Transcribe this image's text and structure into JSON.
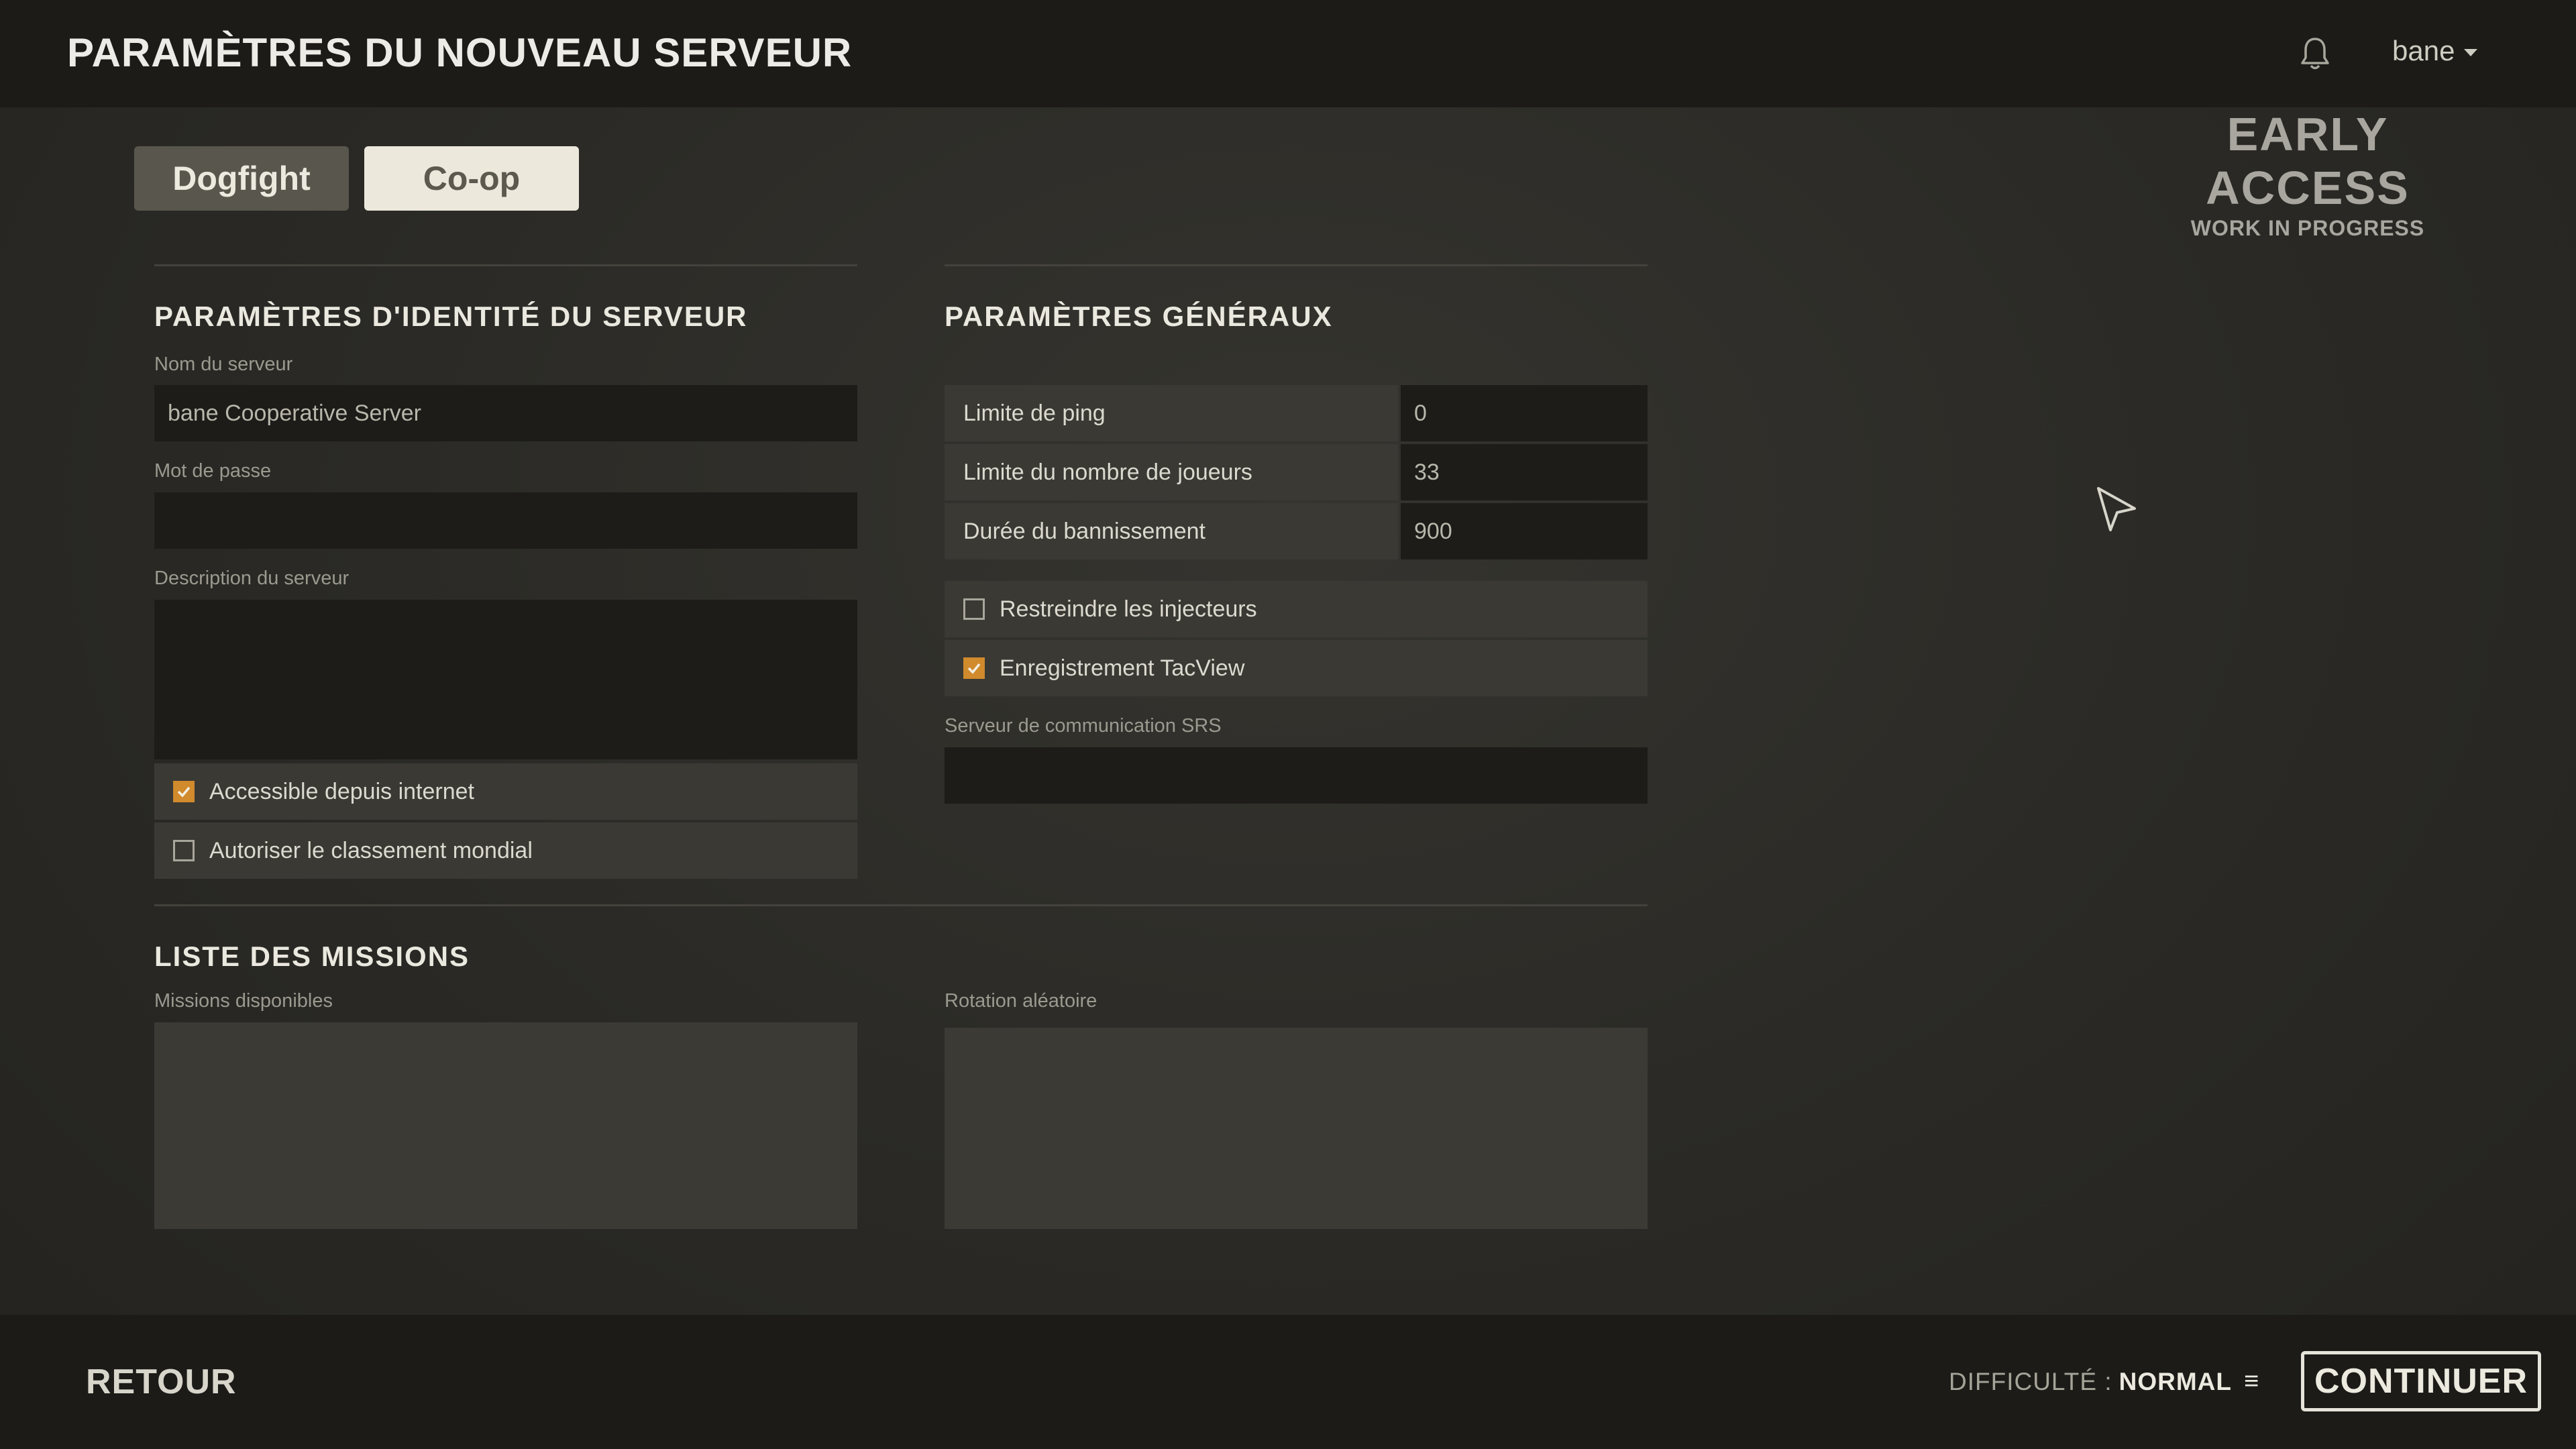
{
  "header": {
    "title": "PARAMÈTRES DU NOUVEAU SERVEUR",
    "notification_icon": "bell-icon",
    "user": "bane"
  },
  "badge": {
    "line1": "EARLY ACCESS",
    "line2": "WORK IN PROGRESS"
  },
  "tabs": [
    {
      "label": "Dogfight",
      "selected": false
    },
    {
      "label": "Co-op",
      "selected": true
    }
  ],
  "identity": {
    "title": "PARAMÈTRES D'IDENTITÉ DU SERVEUR",
    "server_name_label": "Nom du serveur",
    "server_name_value": "bane Cooperative Server",
    "password_label": "Mot de passe",
    "password_value": "",
    "description_label": "Description du serveur",
    "description_value": "",
    "checkboxes": [
      {
        "label": "Accessible depuis internet",
        "checked": true
      },
      {
        "label": "Autoriser le classement mondial",
        "checked": false
      }
    ]
  },
  "general": {
    "title": "PARAMÈTRES GÉNÉRAUX",
    "settings": [
      {
        "label": "Limite de ping",
        "value": "0"
      },
      {
        "label": "Limite du nombre de joueurs",
        "value": "33"
      },
      {
        "label": "Durée du bannissement",
        "value": "900"
      }
    ],
    "checkboxes": [
      {
        "label": "Restreindre les injecteurs",
        "checked": false
      },
      {
        "label": "Enregistrement TacView",
        "checked": true
      }
    ],
    "srs_label": "Serveur de communication SRS",
    "srs_value": ""
  },
  "missions": {
    "title": "LISTE DES MISSIONS",
    "available_label": "Missions disponibles",
    "rotation_label": "Rotation aléatoire"
  },
  "footer": {
    "back": "RETOUR",
    "difficulty_label": "DIFFICULTÉ :",
    "difficulty_value": "NORMAL",
    "difficulty_icon": "≡",
    "continue": "CONTINUER"
  },
  "colors": {
    "accent": "#d18a2c",
    "panel": "#3a3934",
    "field": "#1d1c19"
  }
}
